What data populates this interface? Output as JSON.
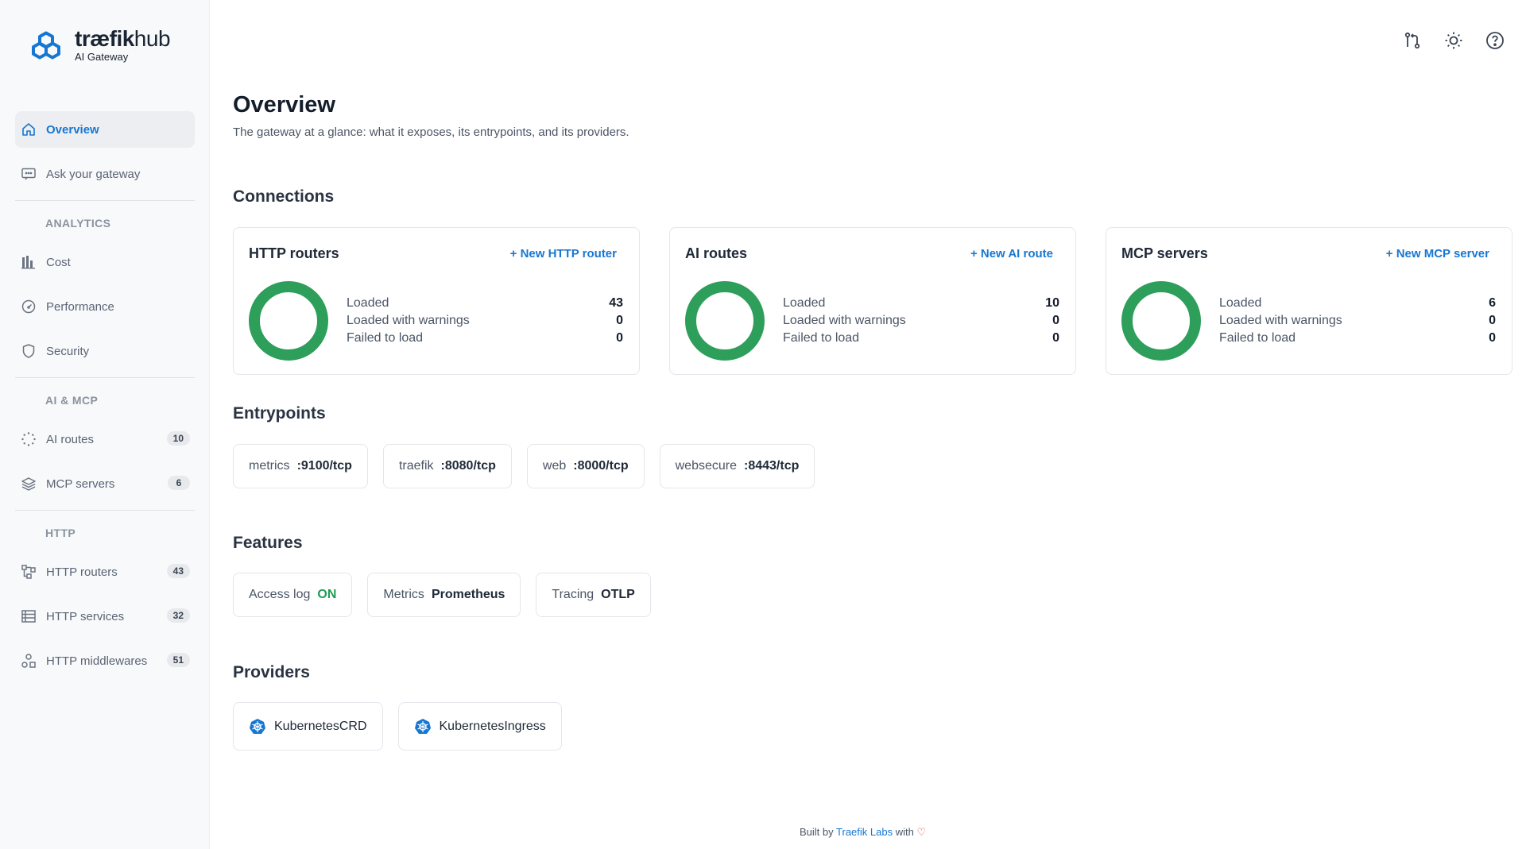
{
  "brand": {
    "name_bold": "træfik",
    "name_light": "hub",
    "subtitle": "AI Gateway"
  },
  "sidebar": {
    "items_top": [
      {
        "label": "Overview",
        "icon": "home-icon",
        "active": true
      },
      {
        "label": "Ask your gateway",
        "icon": "chat-icon"
      }
    ],
    "sections": [
      {
        "title": "ANALYTICS",
        "items": [
          {
            "label": "Cost",
            "icon": "bar-chart-icon"
          },
          {
            "label": "Performance",
            "icon": "gauge-icon"
          },
          {
            "label": "Security",
            "icon": "shield-icon"
          }
        ]
      },
      {
        "title": "AI & MCP",
        "items": [
          {
            "label": "AI routes",
            "icon": "spinner-icon",
            "count": "10"
          },
          {
            "label": "MCP servers",
            "icon": "layers-icon",
            "count": "6"
          }
        ]
      },
      {
        "title": "HTTP",
        "items": [
          {
            "label": "HTTP routers",
            "icon": "network-icon",
            "count": "43"
          },
          {
            "label": "HTTP services",
            "icon": "list-icon",
            "count": "32"
          },
          {
            "label": "HTTP middlewares",
            "icon": "shapes-icon",
            "count": "51"
          }
        ]
      }
    ]
  },
  "topbar": {
    "icons": [
      "git-compare-icon",
      "sun-icon",
      "help-icon"
    ]
  },
  "page": {
    "title": "Overview",
    "subtitle": "The gateway at a glance: what it exposes, its entrypoints, and its providers."
  },
  "connections": {
    "title": "Connections",
    "cards": [
      {
        "title": "HTTP routers",
        "link": "+ New HTTP router",
        "loaded_label": "Loaded",
        "warn_label": "Loaded with warnings",
        "failed_label": "Failed to load",
        "loaded": "43",
        "warn": "0",
        "failed": "0"
      },
      {
        "title": "AI routes",
        "link": "+ New AI route",
        "loaded_label": "Loaded",
        "warn_label": "Loaded with warnings",
        "failed_label": "Failed to load",
        "loaded": "10",
        "warn": "0",
        "failed": "0"
      },
      {
        "title": "MCP servers",
        "link": "+ New MCP server",
        "loaded_label": "Loaded",
        "warn_label": "Loaded with warnings",
        "failed_label": "Failed to load",
        "loaded": "6",
        "warn": "0",
        "failed": "0"
      }
    ],
    "donut_color": "#2e9e5b"
  },
  "entrypoints": {
    "title": "Entrypoints",
    "items": [
      {
        "name": "metrics",
        "addr": ":9100/tcp"
      },
      {
        "name": "traefik",
        "addr": ":8080/tcp"
      },
      {
        "name": "web",
        "addr": ":8000/tcp"
      },
      {
        "name": "websecure",
        "addr": ":8443/tcp"
      }
    ]
  },
  "features": {
    "title": "Features",
    "items": [
      {
        "name": "Access log",
        "value": "ON"
      },
      {
        "name": "Metrics",
        "value": "Prometheus"
      },
      {
        "name": "Tracing",
        "value": "OTLP"
      }
    ]
  },
  "providers": {
    "title": "Providers",
    "items": [
      {
        "name": "KubernetesCRD"
      },
      {
        "name": "KubernetesIngress"
      }
    ]
  },
  "footer": {
    "prefix": "Built by",
    "link": "Traefik Labs",
    "suffix": "with"
  },
  "colors": {
    "accent": "#1677d2",
    "success": "#2e9e5b",
    "heart": "#e0424b"
  }
}
